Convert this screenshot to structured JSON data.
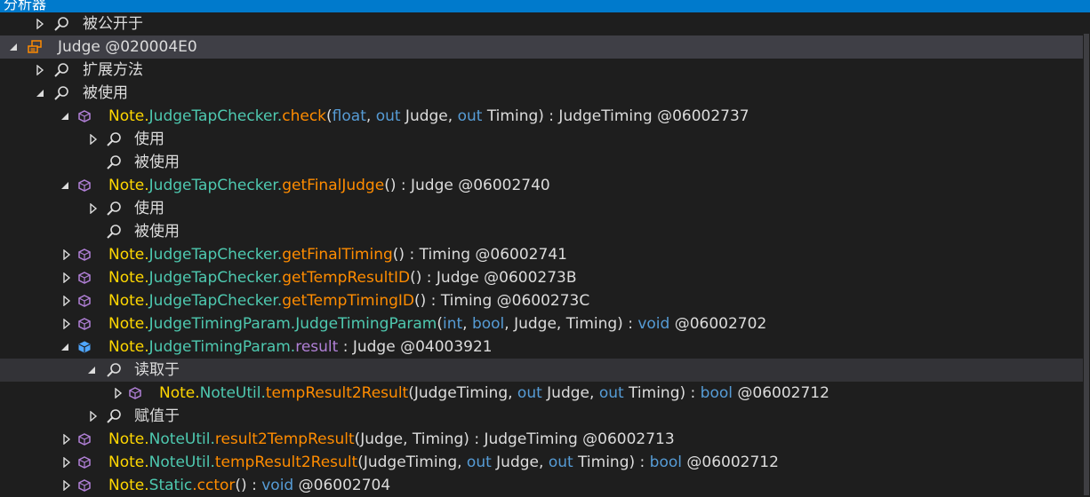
{
  "window": {
    "title": "分析器"
  },
  "tree": {
    "rows": [
      {
        "label": "被公开于"
      },
      {
        "label": "Judge @020004E0"
      },
      {
        "label": "扩展方法"
      },
      {
        "label": "被使用"
      },
      {
        "ns": "Note.",
        "type": "JudgeTapChecker.",
        "method": "check",
        "args_open": "(",
        "a1": "float",
        "s1": ", ",
        "a2": "out",
        "s2": " Judge, ",
        "a3": "out",
        "s3": " Timing) : JudgeTiming @06002737"
      },
      {
        "label": "使用"
      },
      {
        "label": "被使用"
      },
      {
        "ns": "Note.",
        "type": "JudgeTapChecker.",
        "method": "getFinalJudge",
        "rest": "() : Judge @06002740"
      },
      {
        "label": "使用"
      },
      {
        "label": "被使用"
      },
      {
        "ns": "Note.",
        "type": "JudgeTapChecker.",
        "method": "getFinalTiming",
        "rest": "() : Timing @06002741"
      },
      {
        "ns": "Note.",
        "type": "JudgeTapChecker.",
        "method": "getTempResultID",
        "rest": "() : Judge @0600273B"
      },
      {
        "ns": "Note.",
        "type": "JudgeTapChecker.",
        "method": "getTempTimingID",
        "rest": "() : Timing @0600273C"
      },
      {
        "ns": "Note.",
        "type": "JudgeTimingParam.JudgeTimingParam",
        "args_open": "(",
        "a1": "int",
        "s1": ", ",
        "a2": "bool",
        "s2": ", Judge, Timing) : ",
        "a3": "void",
        "s3": " @06002702"
      },
      {
        "ns": "Note.",
        "type": "JudgeTimingParam.",
        "field": "result",
        "rest": " : Judge @04003921"
      },
      {
        "label": "读取于"
      },
      {
        "ns": "Note.",
        "type": "NoteUtil.",
        "method": "tempResult2Result",
        "args_open": "(JudgeTiming, ",
        "a1": "out",
        "s1": " Judge, ",
        "a2": "out",
        "s2": " Timing) : ",
        "a3": "bool",
        "s3": " @06002712"
      },
      {
        "label": "赋值于"
      },
      {
        "ns": "Note.",
        "type": "NoteUtil.",
        "method": "result2TempResult",
        "rest": "(Judge, Timing) : JudgeTiming @06002713"
      },
      {
        "ns": "Note.",
        "type": "NoteUtil.",
        "method": "tempResult2Result",
        "args_open": "(JudgeTiming, ",
        "a1": "out",
        "s1": " Judge, ",
        "a2": "out",
        "s2": " Timing) : ",
        "a3": "bool",
        "s3": " @06002712"
      },
      {
        "ns": "Note.",
        "type": "Static",
        "method": ".cctor",
        "args_open": "() : ",
        "a1": "void",
        "s1": " @06002704"
      }
    ]
  },
  "colors": {
    "background": "#1e1e1e",
    "selected_row": "#3f3f46",
    "namespace": "#ffd700",
    "type": "#4ec9b0",
    "method": "#ff8c00",
    "field": "#b180d7",
    "keyword": "#569cd6",
    "text": "#dcdcdc",
    "method_icon": "#b180d7",
    "field_icon": "#4fa6ff"
  }
}
